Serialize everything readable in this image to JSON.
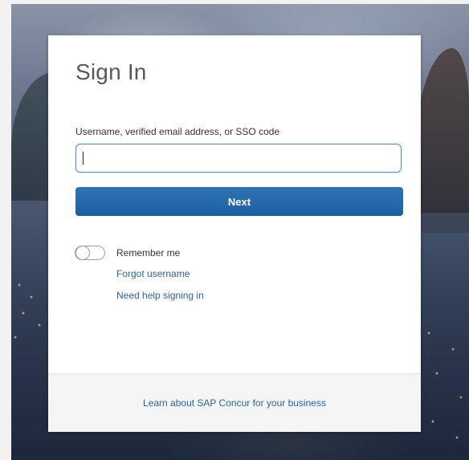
{
  "signin": {
    "title": "Sign In",
    "username_label": "Username, verified email address, or SSO code",
    "username_value": "",
    "next_label": "Next",
    "remember_label": "Remember me",
    "forgot_username_label": "Forgot username",
    "help_label": "Need help signing in"
  },
  "footer": {
    "learn_label": "Learn about SAP Concur for your business"
  },
  "toggle": {
    "remember_on": false
  },
  "colors": {
    "accent": "#1f63a7",
    "link": "#2a62ad",
    "input_focus": "#5a8fd0"
  }
}
